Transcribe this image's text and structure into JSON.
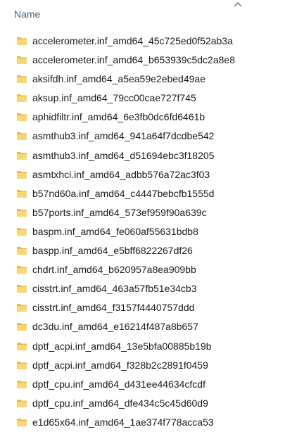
{
  "header": {
    "column_name": "Name",
    "sort_icon": "chevron-up-icon"
  },
  "icon": "folder-icon",
  "colors": {
    "folder_front": "#F8D775",
    "folder_back": "#E6B94A",
    "header_text": "#4C607A"
  },
  "items": [
    {
      "label": "accelerometer.inf_amd64_45c725ed0f52ab3a"
    },
    {
      "label": "accelerometer.inf_amd64_b653939c5dc2a8e8"
    },
    {
      "label": "aksifdh.inf_amd64_a5ea59e2ebed49ae"
    },
    {
      "label": "aksup.inf_amd64_79cc00cae727f745"
    },
    {
      "label": "aphidfiltr.inf_amd64_6e3fb0dc6fd6461b"
    },
    {
      "label": "asmthub3.inf_amd64_941a64f7dcdbe542"
    },
    {
      "label": "asmthub3.inf_amd64_d51694ebc3f18205"
    },
    {
      "label": "asmtxhci.inf_amd64_adbb576a72ac3f03"
    },
    {
      "label": "b57nd60a.inf_amd64_c4447bebcfb1555d"
    },
    {
      "label": "b57ports.inf_amd64_573ef959f90a639c"
    },
    {
      "label": "baspm.inf_amd64_fe060af55631bdb8"
    },
    {
      "label": "baspp.inf_amd64_e5bff6822267df26"
    },
    {
      "label": "chdrt.inf_amd64_b620957a8ea909bb"
    },
    {
      "label": "cisstrt.inf_amd64_463a57fb51e34cb3"
    },
    {
      "label": "cisstrt.inf_amd64_f3157f4440757ddd"
    },
    {
      "label": "dc3du.inf_amd64_e16214f487a8b657"
    },
    {
      "label": "dptf_acpi.inf_amd64_13e5bfa00885b19b"
    },
    {
      "label": "dptf_acpi.inf_amd64_f328b2c2891f0459"
    },
    {
      "label": "dptf_cpu.inf_amd64_d431ee44634cfcdf"
    },
    {
      "label": "dptf_cpu.inf_amd64_dfe434c5c45d60d9"
    },
    {
      "label": "e1d65x64.inf_amd64_1ae374f778acca53"
    }
  ]
}
